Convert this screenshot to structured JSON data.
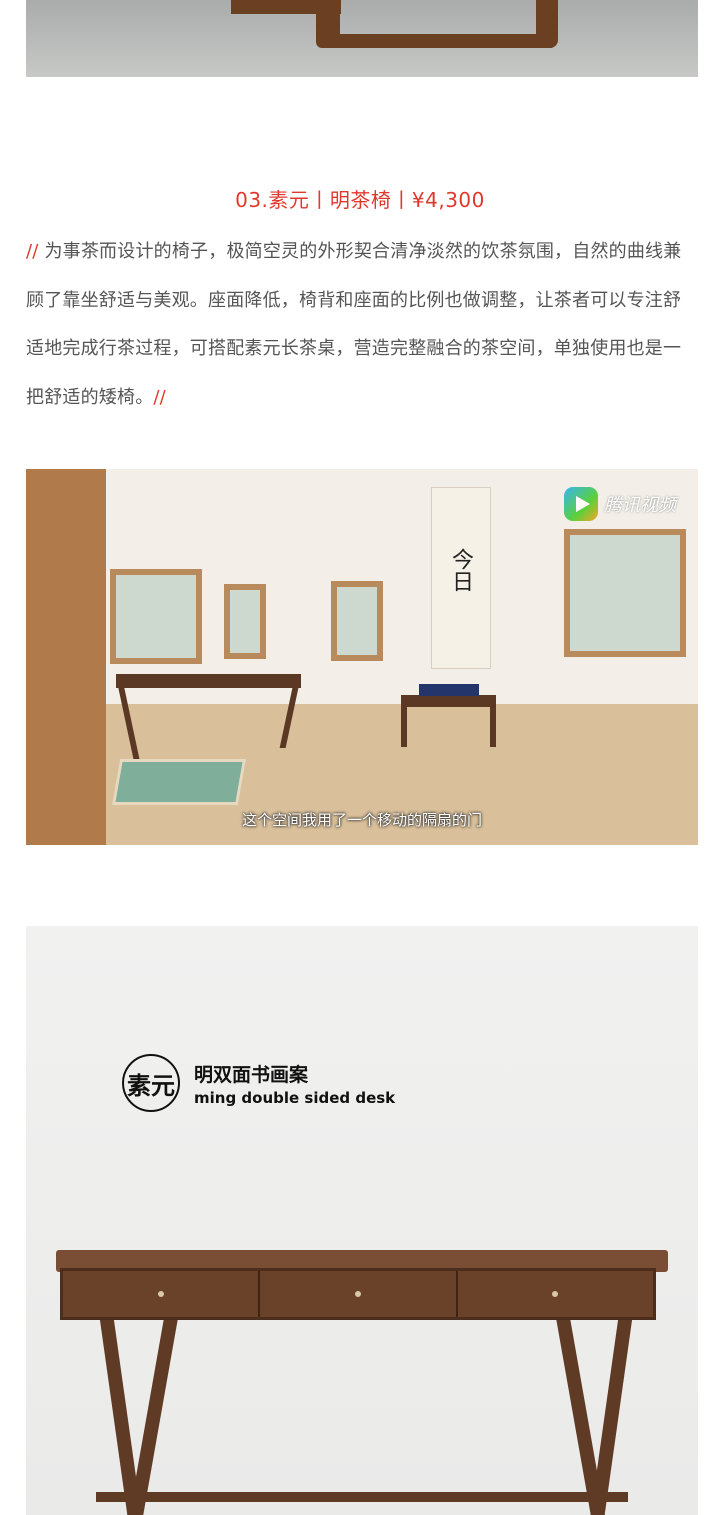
{
  "product": {
    "caption": "03.素元丨明茶椅丨¥4,300",
    "desc_open": "//",
    "desc_body": " 为事茶而设计的椅子，极简空灵的外形契合清净淡然的饮茶氛围，自然的曲线兼顾了靠坐舒适与美观。座面降低，椅背和座面的比例也做调整，让茶者可以专注舒适地完成行茶过程，可搭配素元长茶桌，营造完整融合的茶空间，单独使用也是一把舒适的矮椅。",
    "desc_close": "//"
  },
  "video": {
    "logo_text": "腾讯视频",
    "subtitle": "这个空间我用了一个移动的隔扇的门",
    "scroll_text": "今日"
  },
  "desk_photo": {
    "seal_text": "素元",
    "name_cn": "明双面书画案",
    "name_en": "ming double sided desk"
  },
  "colors": {
    "accent": "#e0392c",
    "body_text": "#555555",
    "walnut": "#6a4129"
  },
  "icons": {
    "video_logo": "tencent-video-play-icon",
    "brand_seal": "suyuan-seal-logo"
  }
}
